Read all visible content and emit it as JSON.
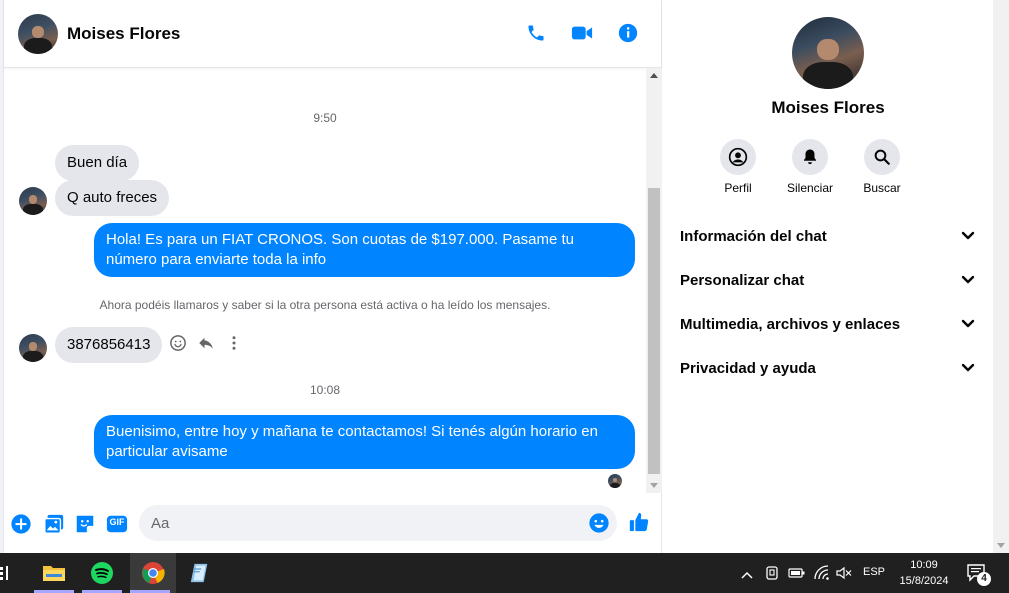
{
  "chat": {
    "contact_name": "Moises Flores",
    "header_icons": [
      "phone-icon",
      "video-camera-icon",
      "info-icon"
    ],
    "messages": [
      {
        "type": "timestamp",
        "text": "9:50"
      },
      {
        "type": "incoming",
        "text": "Buen día"
      },
      {
        "type": "incoming",
        "text": "Q auto freces"
      },
      {
        "type": "outgoing",
        "text": "Hola! Es para un FIAT CRONOS. Son cuotas de $197.000. Pasame tu número para enviarte toda la info"
      },
      {
        "type": "notice",
        "text": "Ahora podéis llamaros y saber si la otra persona está activa o ha leído los mensajes."
      },
      {
        "type": "incoming",
        "text": "3876856413"
      },
      {
        "type": "timestamp",
        "text": "10:08"
      },
      {
        "type": "outgoing",
        "text": "Buenisimo, entre hoy y mañana te contactamos! Si tenés algún horario en particular avisame"
      }
    ],
    "composer": {
      "placeholder": "Aa",
      "icons": [
        "plus-icon",
        "image-icon",
        "sticker-icon",
        "gif-icon",
        "emoji-icon",
        "thumbs-up-icon"
      ],
      "gif_label": "GIF"
    }
  },
  "panel": {
    "name": "Moises Flores",
    "actions": [
      {
        "label": "Perfil",
        "icon": "profile-icon"
      },
      {
        "label": "Silenciar",
        "icon": "bell-icon"
      },
      {
        "label": "Buscar",
        "icon": "search-icon"
      }
    ],
    "sections": [
      {
        "label": "Información del chat"
      },
      {
        "label": "Personalizar chat"
      },
      {
        "label": "Multimedia, archivos y enlaces"
      },
      {
        "label": "Privacidad y ayuda"
      }
    ]
  },
  "taskbar": {
    "apps": [
      "file-explorer-icon",
      "spotify-icon",
      "chrome-icon",
      "notes-icon"
    ],
    "language": "ESP",
    "time": "10:09",
    "date": "15/8/2024",
    "notification_count": "4"
  },
  "colors": {
    "accent": "#0084ff",
    "incoming_bubble": "#e4e6eb",
    "taskbar": "#202020"
  }
}
